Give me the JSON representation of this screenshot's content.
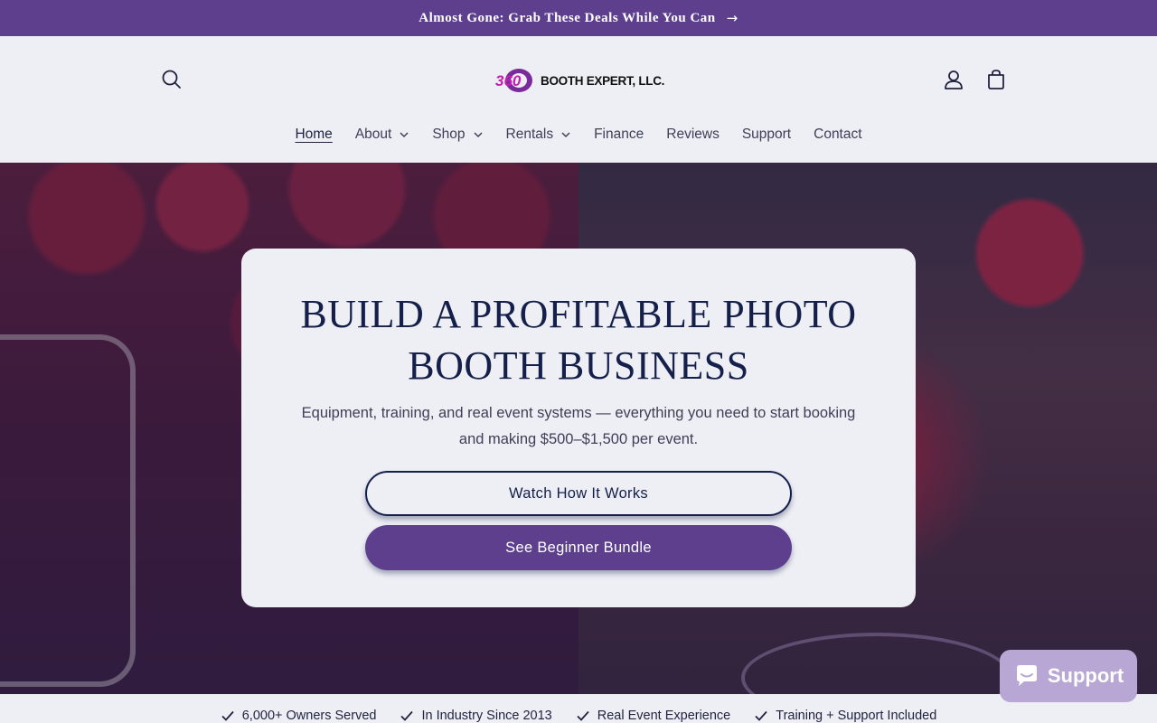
{
  "announcement": {
    "text": "Almost Gone: Grab These Deals While You Can",
    "arrow": "→"
  },
  "header": {
    "logo_mark": "360",
    "logo_text": "BOOTH EXPERT, LLC.",
    "icons": [
      "search-icon",
      "account-icon",
      "cart-icon"
    ]
  },
  "nav": {
    "items": [
      {
        "label": "Home",
        "active": true,
        "dropdown": false
      },
      {
        "label": "About",
        "dropdown": true
      },
      {
        "label": "Shop",
        "dropdown": true
      },
      {
        "label": "Rentals",
        "dropdown": true
      },
      {
        "label": "Finance",
        "dropdown": false
      },
      {
        "label": "Reviews",
        "dropdown": false
      },
      {
        "label": "Support",
        "dropdown": false
      },
      {
        "label": "Contact",
        "dropdown": false
      }
    ]
  },
  "hero": {
    "title_line1": "BUILD A PROFITABLE PHOTO",
    "title_line2": "BOOTH BUSINESS",
    "subtitle": "Equipment, training, and real event systems — everything you need to start booking and making $500–$1,500 per event.",
    "primary_button": "Watch How It Works",
    "secondary_button": "See Beginner Bundle"
  },
  "trust": {
    "items": [
      "6,000+ Owners Served",
      "In Industry Since 2013",
      "Real Event Experience",
      "Training + Support Included"
    ]
  },
  "support_widget": {
    "label": "Support"
  },
  "colors": {
    "brand_purple": "#5d3f8e",
    "navy": "#14204a",
    "background": "#eeeef5",
    "support_bg": "#b8a6d4"
  }
}
